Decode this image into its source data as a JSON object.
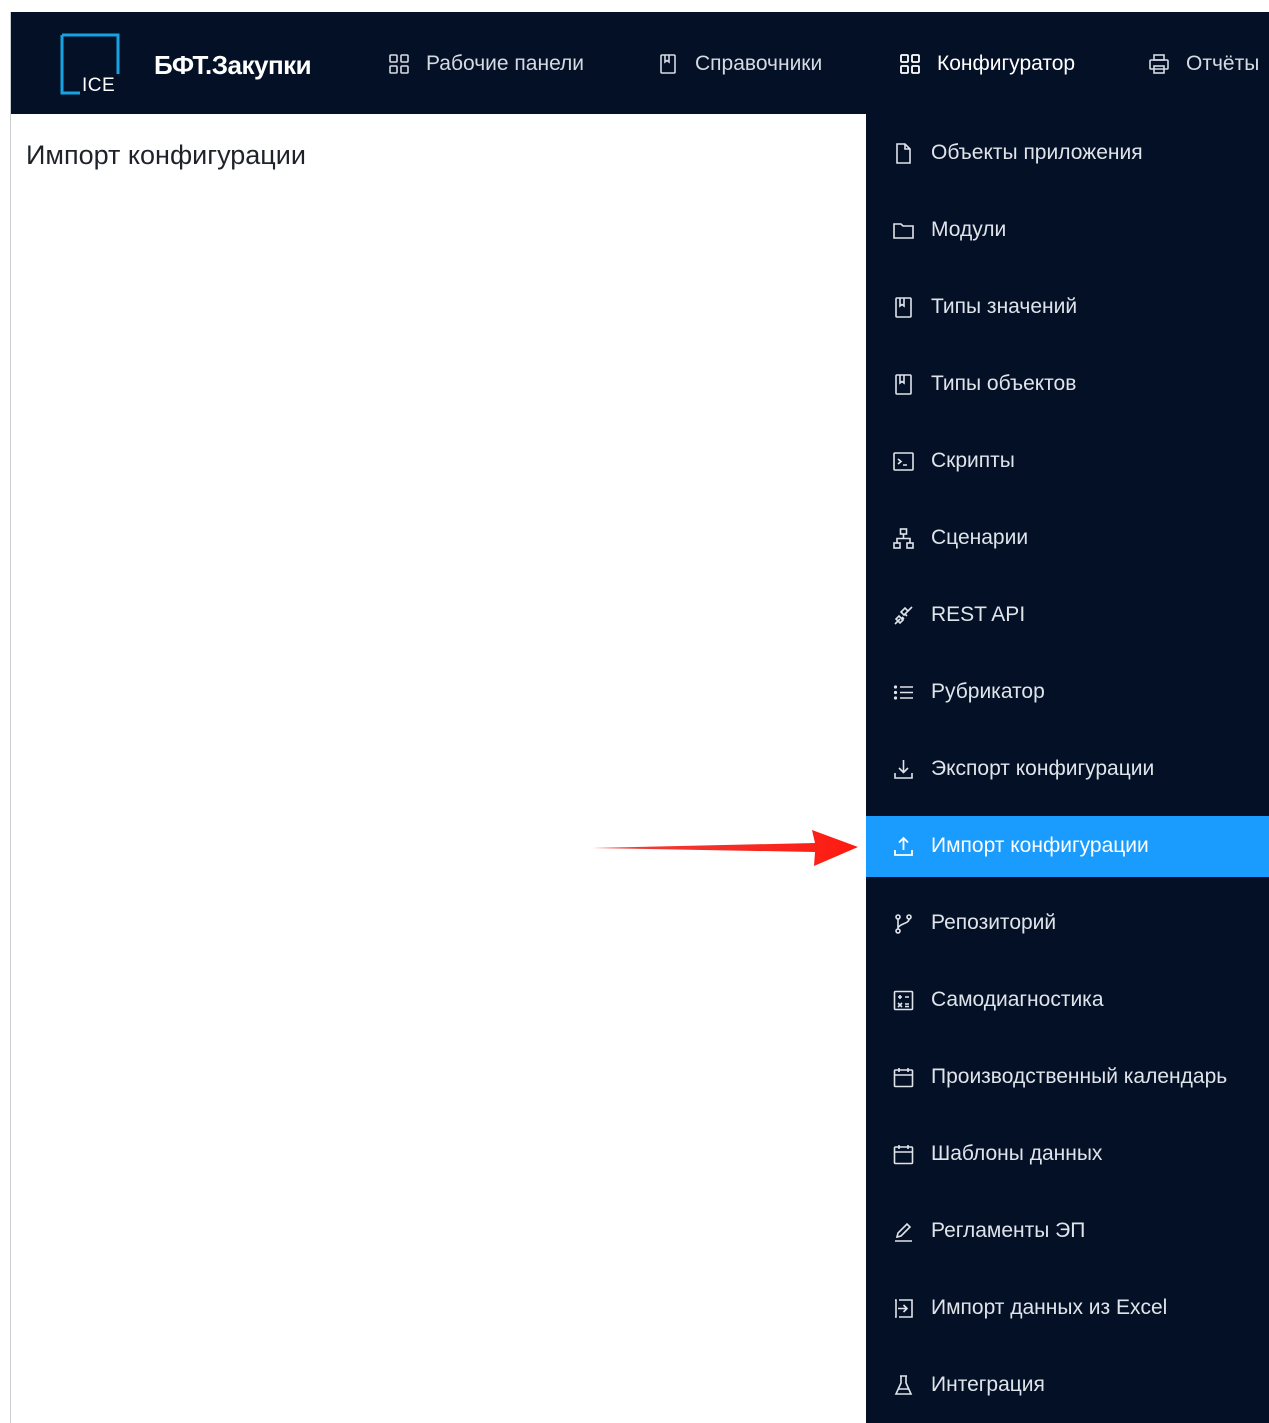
{
  "app": {
    "logo_text": "ICE",
    "brand": "БФТ.Закупки"
  },
  "nav": {
    "items": [
      {
        "label": "Рабочие панели",
        "icon": "grid-icon"
      },
      {
        "label": "Справочники",
        "icon": "book-icon"
      },
      {
        "label": "Конфигуратор",
        "icon": "grid-icon",
        "active": true
      },
      {
        "label": "Отчёты",
        "icon": "printer-icon"
      }
    ]
  },
  "page": {
    "title": "Импорт конфигурации"
  },
  "dropdown": {
    "items": [
      {
        "label": "Объекты приложения",
        "icon": "file-icon"
      },
      {
        "label": "Модули",
        "icon": "folder-icon"
      },
      {
        "label": "Типы значений",
        "icon": "book-icon"
      },
      {
        "label": "Типы объектов",
        "icon": "book-icon"
      },
      {
        "label": "Скрипты",
        "icon": "terminal-icon"
      },
      {
        "label": "Сценарии",
        "icon": "hierarchy-icon"
      },
      {
        "label": "REST API",
        "icon": "plug-icon"
      },
      {
        "label": "Рубрикатор",
        "icon": "list-icon"
      },
      {
        "label": "Экспорт конфигурации",
        "icon": "download-icon"
      },
      {
        "label": "Импорт конфигурации",
        "icon": "upload-icon",
        "active": true
      },
      {
        "label": "Репозиторий",
        "icon": "branch-icon"
      },
      {
        "label": "Самодиагностика",
        "icon": "calculator-icon"
      },
      {
        "label": "Производственный календарь",
        "icon": "calendar-icon"
      },
      {
        "label": "Шаблоны данных",
        "icon": "calendar-icon"
      },
      {
        "label": "Регламенты ЭП",
        "icon": "pen-icon"
      },
      {
        "label": "Импорт данных из Excel",
        "icon": "import-icon"
      },
      {
        "label": "Интеграция",
        "icon": "flask-icon"
      }
    ]
  },
  "colors": {
    "navbar_bg": "#041025",
    "active_item": "#1a9cff",
    "logo_accent": "#16a3e3",
    "arrow": "#e8201a"
  }
}
